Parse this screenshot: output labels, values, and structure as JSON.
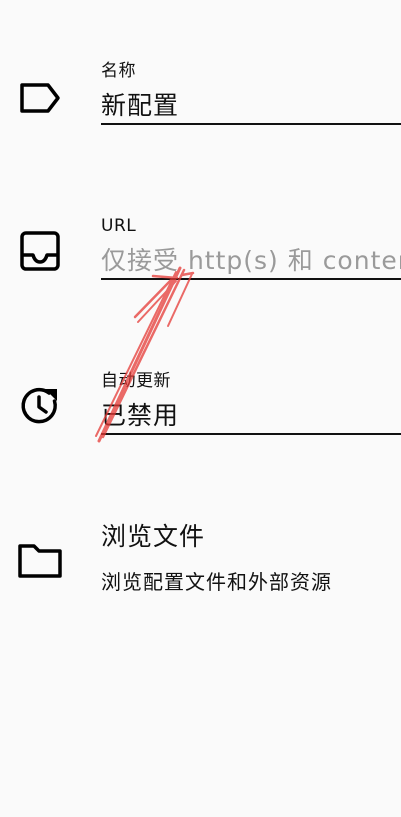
{
  "fields": {
    "name": {
      "label": "名称",
      "value": "新配置",
      "icon": "label-tag-icon"
    },
    "url": {
      "label": "URL",
      "placeholder": "仅接受 http(s) 和 content",
      "icon": "inbox-tray-icon"
    },
    "auto_update": {
      "label": "自动更新",
      "value": "已禁用",
      "icon": "clock-refresh-icon"
    }
  },
  "browse": {
    "title": "浏览文件",
    "subtitle": "浏览配置文件和外部资源",
    "icon": "folder-icon"
  },
  "annotation": {
    "color": "#e53935",
    "icon": "hand-drawn-arrow"
  }
}
